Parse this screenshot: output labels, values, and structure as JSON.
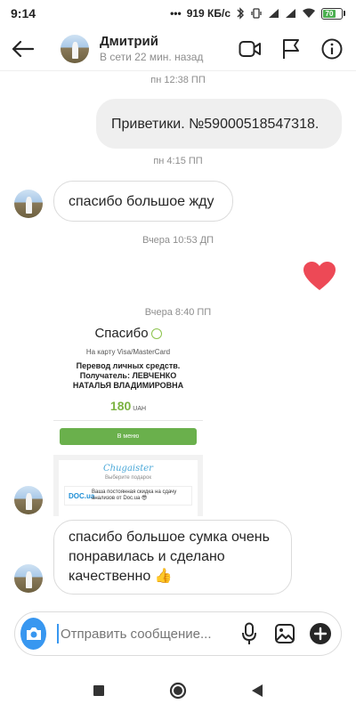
{
  "status_bar": {
    "time": "9:14",
    "speed": "919 КБ/с",
    "battery_level": "70",
    "icons": [
      "dots-icon",
      "bluetooth-icon",
      "vibrate-icon",
      "signal-icon",
      "signal-icon",
      "wifi-icon",
      "battery-icon"
    ]
  },
  "header": {
    "name": "Дмитрий",
    "status": "В сети 22 мин. назад",
    "icons": [
      "back-arrow-icon",
      "video-call-icon",
      "flag-icon",
      "info-icon"
    ]
  },
  "messages": [
    {
      "type": "timestamp",
      "text": "пн 12:38 ПП"
    },
    {
      "type": "outgoing",
      "text": "Приветики. №59000518547318."
    },
    {
      "type": "timestamp",
      "text": "пн 4:15 ПП"
    },
    {
      "type": "incoming",
      "text": "спасибо большое жду"
    },
    {
      "type": "timestamp",
      "text": "Вчера 10:53 ДП"
    },
    {
      "type": "outgoing-heart",
      "icon": "heart-icon",
      "color": "#ed4956"
    },
    {
      "type": "timestamp",
      "text": "Вчера 8:40 ПП"
    },
    {
      "type": "incoming-image"
    },
    {
      "type": "incoming",
      "text": "спасибо большое сумка очень понравилась и сделано качественно 👍"
    }
  ],
  "shared_image": {
    "title": "Спасибо",
    "card": "На карту Visa/MasterCard",
    "purpose_lines": [
      "Перевод личных средств.",
      "Получатель: ЛЕВЧЕНКО",
      "НАТАЛЬЯ ВЛАДИМИРОВНА"
    ],
    "amount": "180",
    "currency": "UAH",
    "button": "В меню",
    "brand": "Chugaister",
    "gift_hint": "Выберите подарок",
    "partner": "DOC.ua",
    "offer": "Ваша постоянная скидка на сдачу анализов от Doc.ua 😎"
  },
  "composer": {
    "placeholder": "Отправить сообщение...",
    "icons": [
      "camera-icon",
      "microphone-icon",
      "gallery-icon",
      "plus-icon"
    ]
  },
  "nav": {
    "icons": [
      "recents-icon",
      "home-icon",
      "back-icon"
    ]
  },
  "colors": {
    "accent": "#3897f0",
    "heart": "#ed4956",
    "outgoing_bubble": "#efefef",
    "incoming_border": "#dbdbdb",
    "battery": "#4caf50"
  }
}
